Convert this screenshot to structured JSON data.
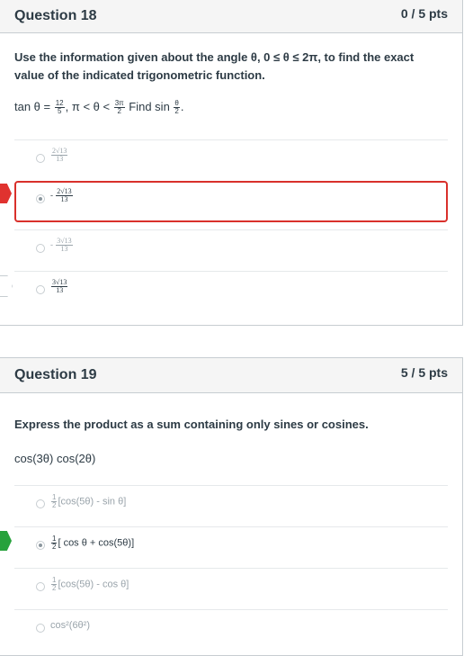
{
  "q18": {
    "title": "Question 18",
    "points": "0 / 5 pts",
    "prompt": "Use the information given about the angle θ, 0 ≤ θ ≤ 2π, to find the exact value of the indicated trigonometric function.",
    "given": {
      "lead": "tan θ = ",
      "frac1_num": "12",
      "frac1_den": "5",
      "mid": ", π < θ < ",
      "frac2_num": "3π",
      "frac2_den": "2",
      "find": " Find sin ",
      "frac3_num": "θ",
      "frac3_den": "2",
      "end": "."
    },
    "answers": [
      {
        "sign": "",
        "num": "2√13",
        "den": "13"
      },
      {
        "sign": "- ",
        "num": "2√13",
        "den": "13"
      },
      {
        "sign": "- ",
        "num": "3√13",
        "den": "13"
      },
      {
        "sign": "",
        "num": "3√13",
        "den": "13"
      }
    ]
  },
  "q19": {
    "title": "Question 19",
    "points": "5 / 5 pts",
    "prompt": "Express the product as a sum containing only sines or cosines.",
    "expression": "cos(3θ) cos(2θ)",
    "answers": [
      {
        "half_num": "1",
        "half_den": "2",
        "text": "[cos(5θ) - sin θ]"
      },
      {
        "half_num": "1",
        "half_den": "2",
        "text": "[ cos θ + cos(5θ)]"
      },
      {
        "half_num": "1",
        "half_den": "2",
        "text": "[cos(5θ) - cos θ]"
      },
      {
        "text": "cos²(6θ²)"
      }
    ]
  },
  "colors": {
    "wrong": "#d9302b",
    "correct": "#27a23c",
    "border": "#c7cdd1"
  }
}
